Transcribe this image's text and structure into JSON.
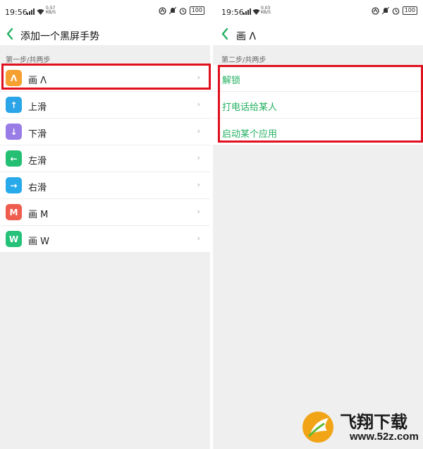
{
  "status_bar": {
    "left": {
      "time": "19:56",
      "speed_value": "0.57",
      "speed_unit": "KB/S"
    },
    "right": {
      "time": "19:56",
      "speed_value": "0.03",
      "speed_unit": "KB/S"
    },
    "battery": "100"
  },
  "left_screen": {
    "title": "添加一个黑屏手势",
    "section_label": "第一步/共两步",
    "items": [
      {
        "glyph": "Λ",
        "label": "画 Λ",
        "color": "#f5a030"
      },
      {
        "glyph": "↑",
        "label": "上滑",
        "color": "#2ba4e8"
      },
      {
        "glyph": "↓",
        "label": "下滑",
        "color": "#9a7ce6"
      },
      {
        "glyph": "←",
        "label": "左滑",
        "color": "#25bf74"
      },
      {
        "glyph": "→",
        "label": "右滑",
        "color": "#28a9ea"
      },
      {
        "glyph": "M",
        "label": "画 M",
        "color": "#ef5d4e"
      },
      {
        "glyph": "W",
        "label": "画 W",
        "color": "#27c27a"
      }
    ]
  },
  "right_screen": {
    "title": "画 Λ",
    "section_label": "第二步/共两步",
    "actions": [
      "解锁",
      "打电话给某人",
      "启动某个应用"
    ]
  },
  "watermark": {
    "text": "飞翔下载",
    "url": "www.52z.com"
  },
  "colors": {
    "accent_green": "#23b060",
    "highlight_red": "#e0101e"
  }
}
